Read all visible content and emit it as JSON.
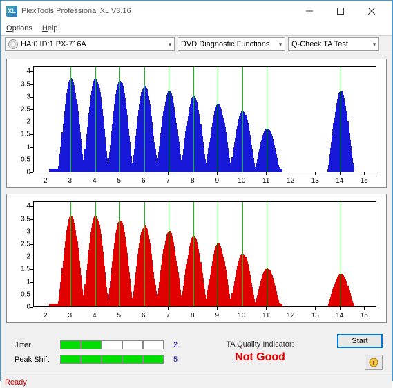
{
  "window": {
    "title": "PlexTools Professional XL V3.16"
  },
  "menu": {
    "options": "Options",
    "help": "Help"
  },
  "toolbar": {
    "device": "HA:0 ID:1  PX-716A",
    "functions": "DVD Diagnostic Functions",
    "test": "Q-Check TA Test"
  },
  "chart_data": [
    {
      "type": "bar",
      "color": "#1818d8",
      "xlim": [
        1.5,
        15.5
      ],
      "ylim": [
        0,
        4.2
      ],
      "xticks": [
        2,
        3,
        4,
        5,
        6,
        7,
        8,
        9,
        10,
        11,
        12,
        13,
        14,
        15
      ],
      "yticks": [
        0,
        0.5,
        1,
        1.5,
        2,
        2.5,
        3,
        3.5,
        4
      ],
      "gridlines_x": [
        3,
        4,
        5,
        6,
        7,
        8,
        9,
        10,
        11,
        14
      ],
      "peaks": [
        {
          "x": 3,
          "y": 3.7
        },
        {
          "x": 4,
          "y": 3.7
        },
        {
          "x": 5,
          "y": 3.6
        },
        {
          "x": 6,
          "y": 3.4
        },
        {
          "x": 7,
          "y": 3.2
        },
        {
          "x": 8,
          "y": 3.0
        },
        {
          "x": 9,
          "y": 2.7
        },
        {
          "x": 10,
          "y": 2.4
        },
        {
          "x": 11,
          "y": 1.7
        },
        {
          "x": 14,
          "y": 3.2
        }
      ]
    },
    {
      "type": "bar",
      "color": "#e00000",
      "xlim": [
        1.5,
        15.5
      ],
      "ylim": [
        0,
        4.2
      ],
      "xticks": [
        2,
        3,
        4,
        5,
        6,
        7,
        8,
        9,
        10,
        11,
        12,
        13,
        14,
        15
      ],
      "yticks": [
        0,
        0.5,
        1,
        1.5,
        2,
        2.5,
        3,
        3.5,
        4
      ],
      "gridlines_x": [
        3,
        4,
        5,
        6,
        7,
        8,
        9,
        10,
        11,
        14
      ],
      "peaks": [
        {
          "x": 3,
          "y": 3.6
        },
        {
          "x": 4,
          "y": 3.6
        },
        {
          "x": 5,
          "y": 3.4
        },
        {
          "x": 6,
          "y": 3.2
        },
        {
          "x": 7,
          "y": 3.0
        },
        {
          "x": 8,
          "y": 2.8
        },
        {
          "x": 9,
          "y": 2.5
        },
        {
          "x": 10,
          "y": 2.1
        },
        {
          "x": 11,
          "y": 1.5
        },
        {
          "x": 14,
          "y": 1.3
        }
      ]
    }
  ],
  "metrics": {
    "jitter": {
      "label": "Jitter",
      "segments": 5,
      "filled": 2,
      "value": "2"
    },
    "peakshift": {
      "label": "Peak Shift",
      "segments": 5,
      "filled": 5,
      "value": "5"
    }
  },
  "quality": {
    "label": "TA Quality Indicator:",
    "value": "Not Good"
  },
  "buttons": {
    "start": "Start"
  },
  "status": {
    "text": "Ready"
  }
}
